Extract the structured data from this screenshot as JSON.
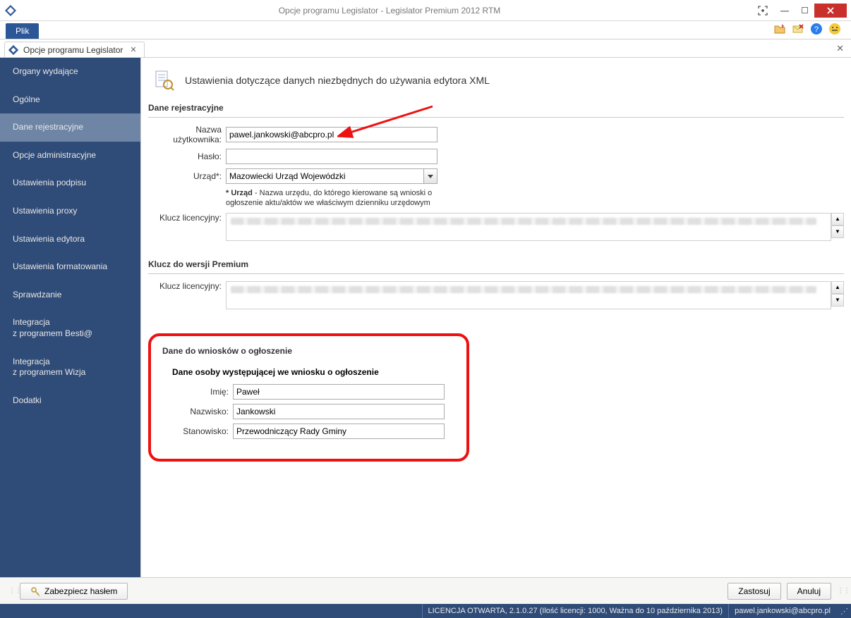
{
  "window": {
    "title": "Opcje programu Legislator - Legislator Premium 2012 RTM"
  },
  "ribbon": {
    "file_label": "Plik"
  },
  "tab": {
    "label": "Opcje programu Legislator"
  },
  "sidebar": {
    "items": [
      "Organy wydające",
      "Ogólne",
      "Dane rejestracyjne",
      "Opcje administracyjne",
      "Ustawienia podpisu",
      "Ustawienia proxy",
      "Ustawienia edytora",
      "Ustawienia formatowania",
      "Sprawdzanie",
      "Integracja\nz programem Besti@",
      "Integracja\nz programem Wizja",
      "Dodatki"
    ],
    "active_index": 2
  },
  "page": {
    "heading": "Ustawienia dotyczące danych niezbędnych do używania edytora XML",
    "section_reg": "Dane rejestracyjne",
    "labels": {
      "username": "Nazwa użytkownika:",
      "password": "Hasło:",
      "office": "Urząd*:",
      "license": "Klucz licencyjny:"
    },
    "values": {
      "username": "pawel.jankowski@abcpro.pl",
      "password": "",
      "office": "Mazowiecki Urząd Wojewódzki"
    },
    "office_hint_bold": "* Urząd",
    "office_hint": " - Nazwa urzędu, do którego kierowane są wnioski o ogłoszenie aktu/aktów we właściwym dzienniku urzędowym",
    "section_premium": "Klucz do wersji Premium",
    "section_request": "Dane do wniosków o ogłoszenie",
    "person_heading": "Dane osoby występującej we wniosku o ogłoszenie",
    "person_labels": {
      "first": "Imię:",
      "last": "Nazwisko:",
      "position": "Stanowisko:"
    },
    "person_values": {
      "first": "Paweł",
      "last": "Jankowski",
      "position": "Przewodniczący Rady Gminy"
    }
  },
  "footer": {
    "secure": "Zabezpiecz hasłem",
    "apply": "Zastosuj",
    "cancel": "Anuluj"
  },
  "status": {
    "license": "LICENCJA OTWARTA, 2.1.0.27 (Ilość licencji: 1000, Ważna do 10 października 2013)",
    "user": "pawel.jankowski@abcpro.pl"
  }
}
